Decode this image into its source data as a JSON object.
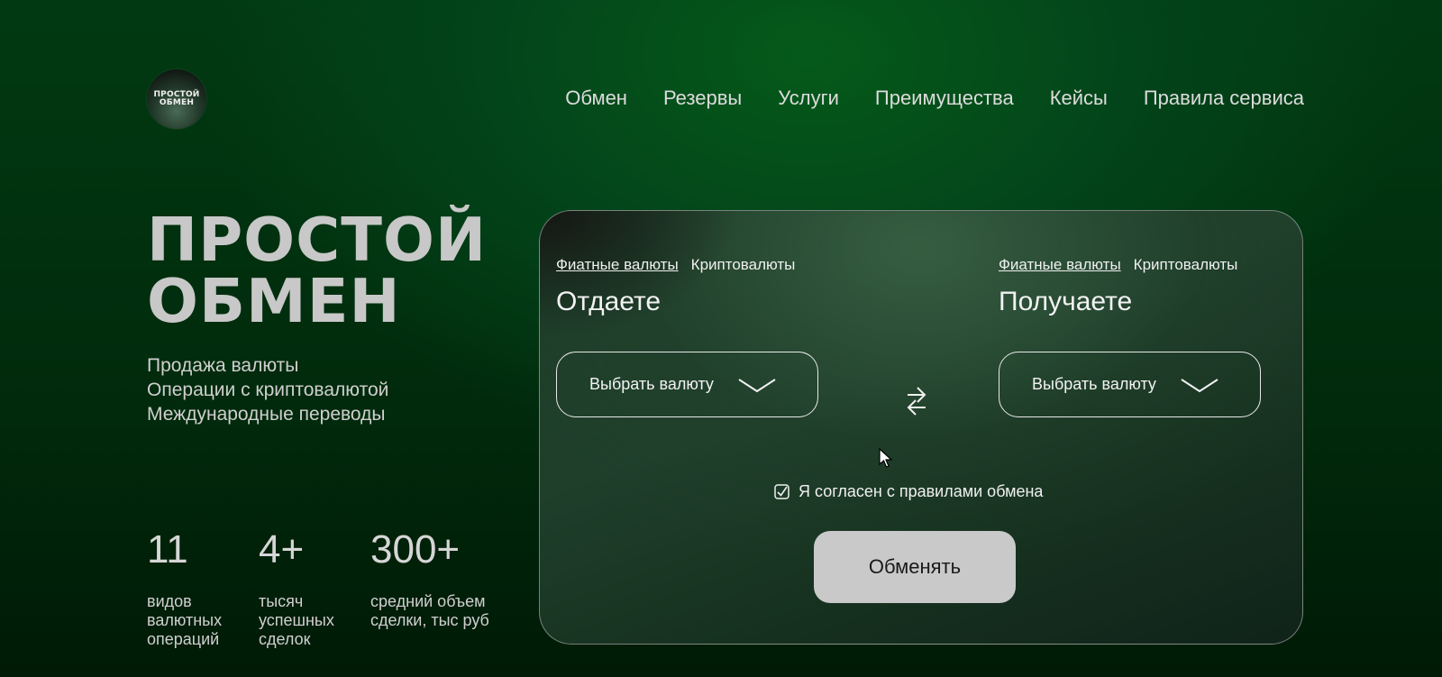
{
  "logo": {
    "line1": "ПРОСТОЙ",
    "line2": "ОБМЕН"
  },
  "nav": {
    "items": [
      "Обмен",
      "Резервы",
      "Услуги",
      "Преимущества",
      "Кейсы",
      "Правила сервиса"
    ]
  },
  "hero": {
    "title_line1": "ПРОСТОЙ",
    "title_line2": "ОБМЕН",
    "subtitles": [
      "Продажа валюты",
      "Операции с криптовалютой",
      "Международные переводы"
    ]
  },
  "stats": [
    {
      "num": "11",
      "label_lines": [
        "видов",
        "валютных",
        "операций"
      ]
    },
    {
      "num": "4+",
      "label_lines": [
        "тысяч",
        "успешных",
        "сделок"
      ]
    },
    {
      "num": "300+",
      "label_lines": [
        "средний объем",
        "сделки, тыс руб"
      ]
    }
  ],
  "exchange": {
    "give": {
      "tab_fiat": "Фиатные валюты",
      "tab_crypto": "Криптовалюты",
      "title": "Отдаете",
      "select_label": "Выбрать валюту"
    },
    "receive": {
      "tab_fiat": "Фиатные валюты",
      "tab_crypto": "Криптовалюты",
      "title": "Получаете",
      "select_label": "Выбрать валюту"
    },
    "agree_label": "Я согласен с правилами обмена",
    "submit_label": "Обменять"
  },
  "colors": {
    "accent": "#c9c9c9",
    "background": "#013a12"
  }
}
